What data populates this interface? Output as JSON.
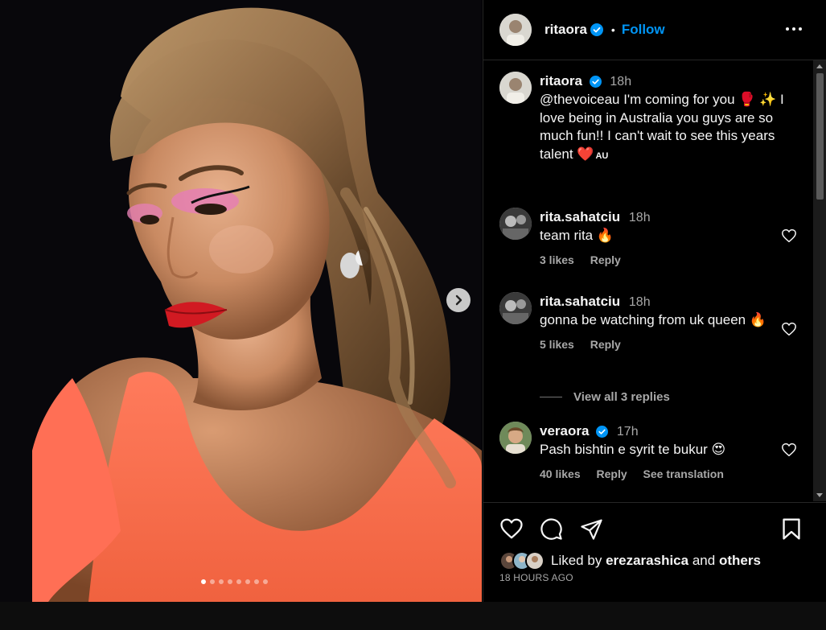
{
  "post": {
    "username": "ritaora",
    "follow_label": "Follow",
    "bullet": "•",
    "caption_time": "18h",
    "caption_text": "@thevoiceau I'm coming for you 🥊 ✨ I love being in Australia you guys are so much fun!! I can't wait to see this years talent ❤️",
    "caption_badge": "AU",
    "carousel_count": 8,
    "carousel_active": 0
  },
  "comments": [
    {
      "username": "rita.sahatciu",
      "time": "18h",
      "text": "team rita 🔥",
      "likes": "3 likes",
      "reply": "Reply"
    },
    {
      "username": "rita.sahatciu",
      "time": "18h",
      "text": "gonna be watching from uk queen 🔥",
      "likes": "5 likes",
      "reply": "Reply"
    },
    {
      "username": "veraora",
      "time": "17h",
      "text": "Pash bishtin e syrit te bukur 😍",
      "likes": "40 likes",
      "reply": "Reply",
      "translate": "See translation"
    }
  ],
  "view_replies": "View all 3 replies",
  "likes": {
    "prefix": "Liked by",
    "user": "erezarashica",
    "and": "and",
    "others": "others"
  },
  "timestamp": "18 HOURS AGO",
  "icons": [
    "more-icon",
    "verified-icon",
    "heart-icon",
    "comment-icon",
    "share-icon",
    "save-icon",
    "next-arrow-icon"
  ],
  "colors": {
    "accent": "#0095f6",
    "verified": "#0095f6",
    "background": "#000000",
    "secondary_text": "#a8a8a8"
  }
}
